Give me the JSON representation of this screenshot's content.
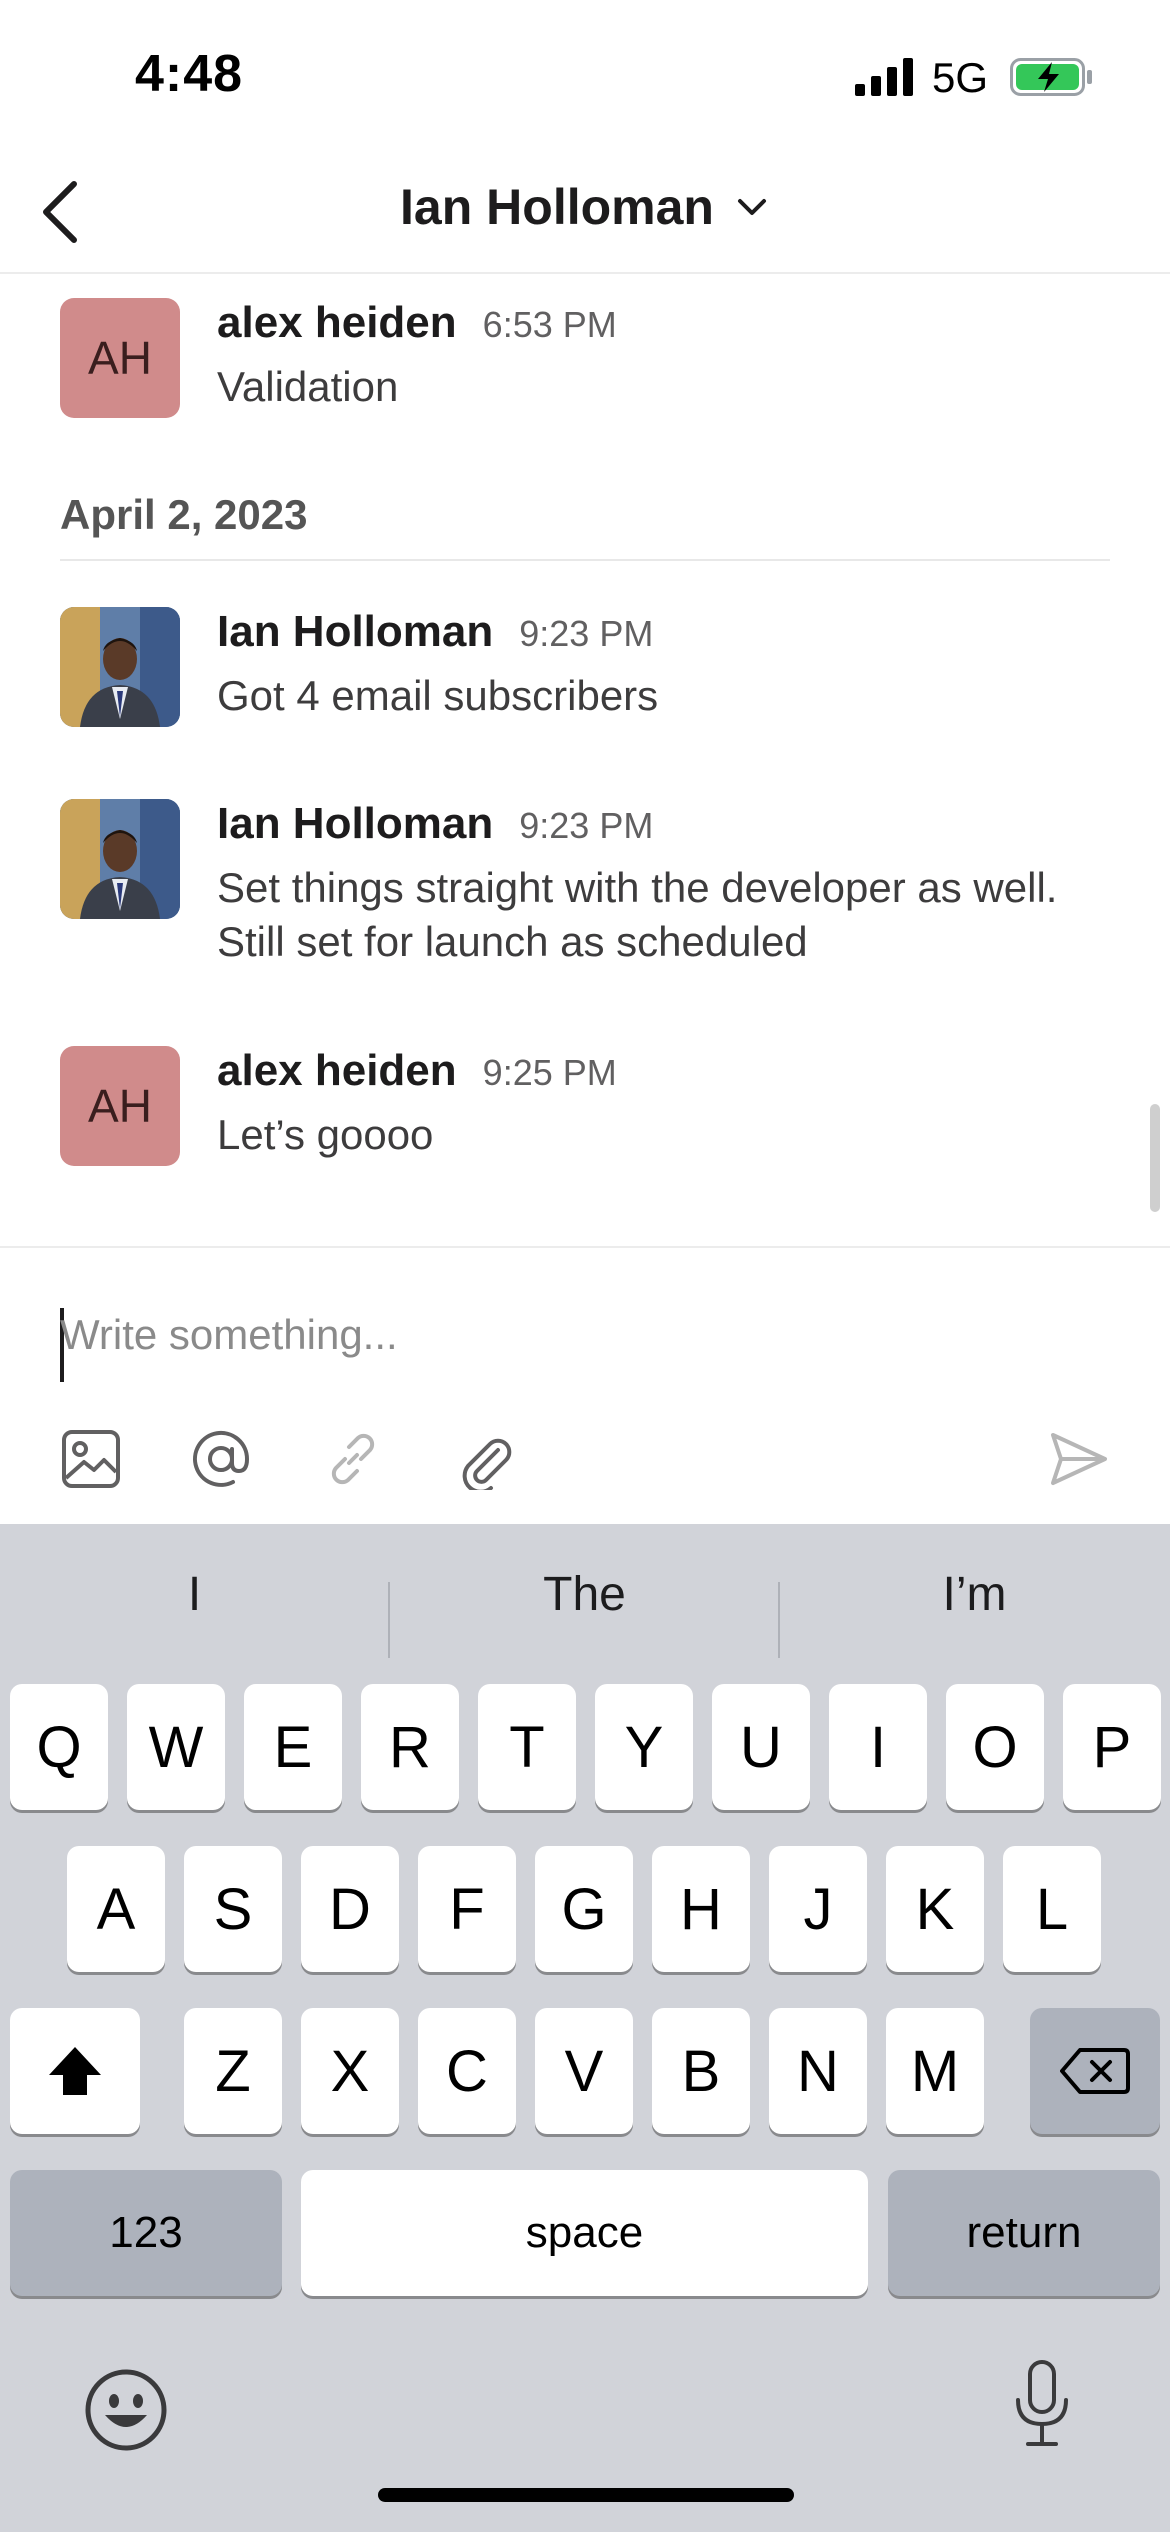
{
  "status_bar": {
    "time": "4:48",
    "network": "5G",
    "battery_charging": true,
    "battery_color": "#34c759"
  },
  "nav": {
    "title": "Ian Holloman"
  },
  "messages": [
    {
      "avatar_initials": "AH",
      "name": "alex heiden",
      "time": "6:53 PM",
      "text": "Validation"
    },
    {
      "name": "Ian Holloman",
      "time": "9:23 PM",
      "text": "Got 4 email subscribers"
    },
    {
      "name": "Ian Holloman",
      "time": "9:23 PM",
      "text": "Set things straight with the developer as well. Still set for launch as scheduled"
    },
    {
      "avatar_initials": "AH",
      "name": "alex heiden",
      "time": "9:25 PM",
      "text": "Let’s goooo"
    }
  ],
  "date_separator": "April 2, 2023",
  "composer": {
    "placeholder": "Write something..."
  },
  "keyboard": {
    "suggestions": [
      "I",
      "The",
      "I’m"
    ],
    "row1": [
      "Q",
      "W",
      "E",
      "R",
      "T",
      "Y",
      "U",
      "I",
      "O",
      "P"
    ],
    "row2": [
      "A",
      "S",
      "D",
      "F",
      "G",
      "H",
      "J",
      "K",
      "L"
    ],
    "row3": [
      "Z",
      "X",
      "C",
      "V",
      "B",
      "N",
      "M"
    ],
    "numbers_label": "123",
    "space_label": "space",
    "return_label": "return"
  },
  "colors": {
    "avatar_initials_bg": "#d08b8b",
    "keyboard_bg": "#d1d3d9"
  }
}
